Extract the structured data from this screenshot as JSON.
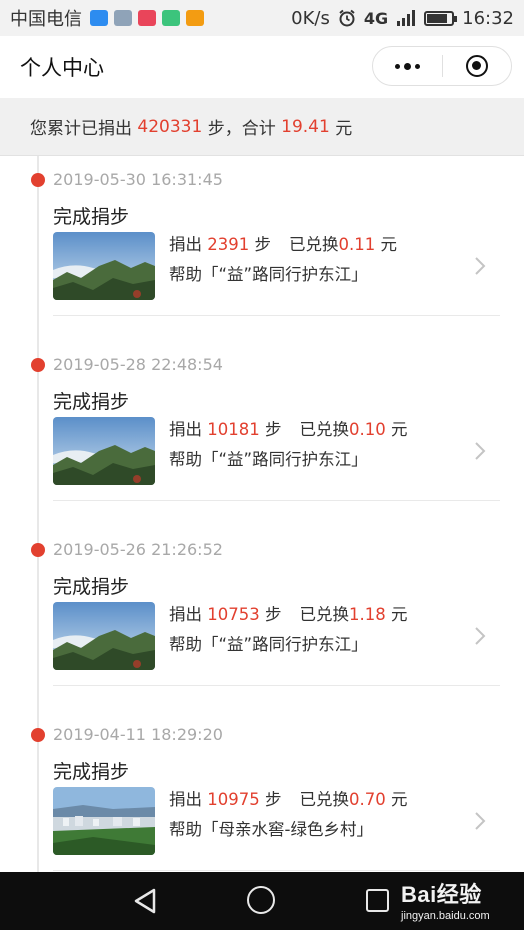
{
  "status_bar": {
    "carrier": "中国电信",
    "net_speed": "0K/s",
    "network": "4G",
    "time": "16:32",
    "battery_level": 0.85,
    "app_icon_colors": [
      "#2d8cf0",
      "#8fa3b8",
      "#e9455a",
      "#3cc47c",
      "#f39c12"
    ]
  },
  "header": {
    "title": "个人中心",
    "menu_icon": "more-dots-icon",
    "close_icon": "target-circle-icon"
  },
  "summary": {
    "prefix": "您累计已捐出",
    "steps": "420331",
    "steps_unit": "步，合计",
    "amount": "19.41",
    "currency": "元"
  },
  "entries": [
    {
      "time": "2019-05-30 16:31:45",
      "title": "完成捐步",
      "donate_label": "捐出",
      "steps": "2391",
      "steps_unit": "步",
      "exchange_label": "已兑换",
      "amount": "0.11",
      "currency": "元",
      "project": "帮助「“益”路同行护东江」",
      "thumb": "mountains"
    },
    {
      "time": "2019-05-28 22:48:54",
      "title": "完成捐步",
      "donate_label": "捐出",
      "steps": "10181",
      "steps_unit": "步",
      "exchange_label": "已兑换",
      "amount": "0.10",
      "currency": "元",
      "project": "帮助「“益”路同行护东江」",
      "thumb": "mountains"
    },
    {
      "time": "2019-05-26 21:26:52",
      "title": "完成捐步",
      "donate_label": "捐出",
      "steps": "10753",
      "steps_unit": "步",
      "exchange_label": "已兑换",
      "amount": "1.18",
      "currency": "元",
      "project": "帮助「“益”路同行护东江」",
      "thumb": "mountains"
    },
    {
      "time": "2019-04-11 18:29:20",
      "title": "完成捐步",
      "donate_label": "捐出",
      "steps": "10975",
      "steps_unit": "步",
      "exchange_label": "已兑换",
      "amount": "0.70",
      "currency": "元",
      "project": "帮助「母亲水窖-绿色乡村」",
      "thumb": "village"
    }
  ],
  "nav_bar": {
    "back_icon": "back-triangle-icon",
    "home_icon": "home-circle-icon",
    "recent_icon": "recent-square-icon"
  },
  "watermark": {
    "brand": "Bai经验",
    "url": "jingyan.baidu.com"
  },
  "colors": {
    "accent_red": "#e2402f",
    "summary_bg": "#f0f0f0",
    "nav_bg": "#0d0d0d"
  }
}
